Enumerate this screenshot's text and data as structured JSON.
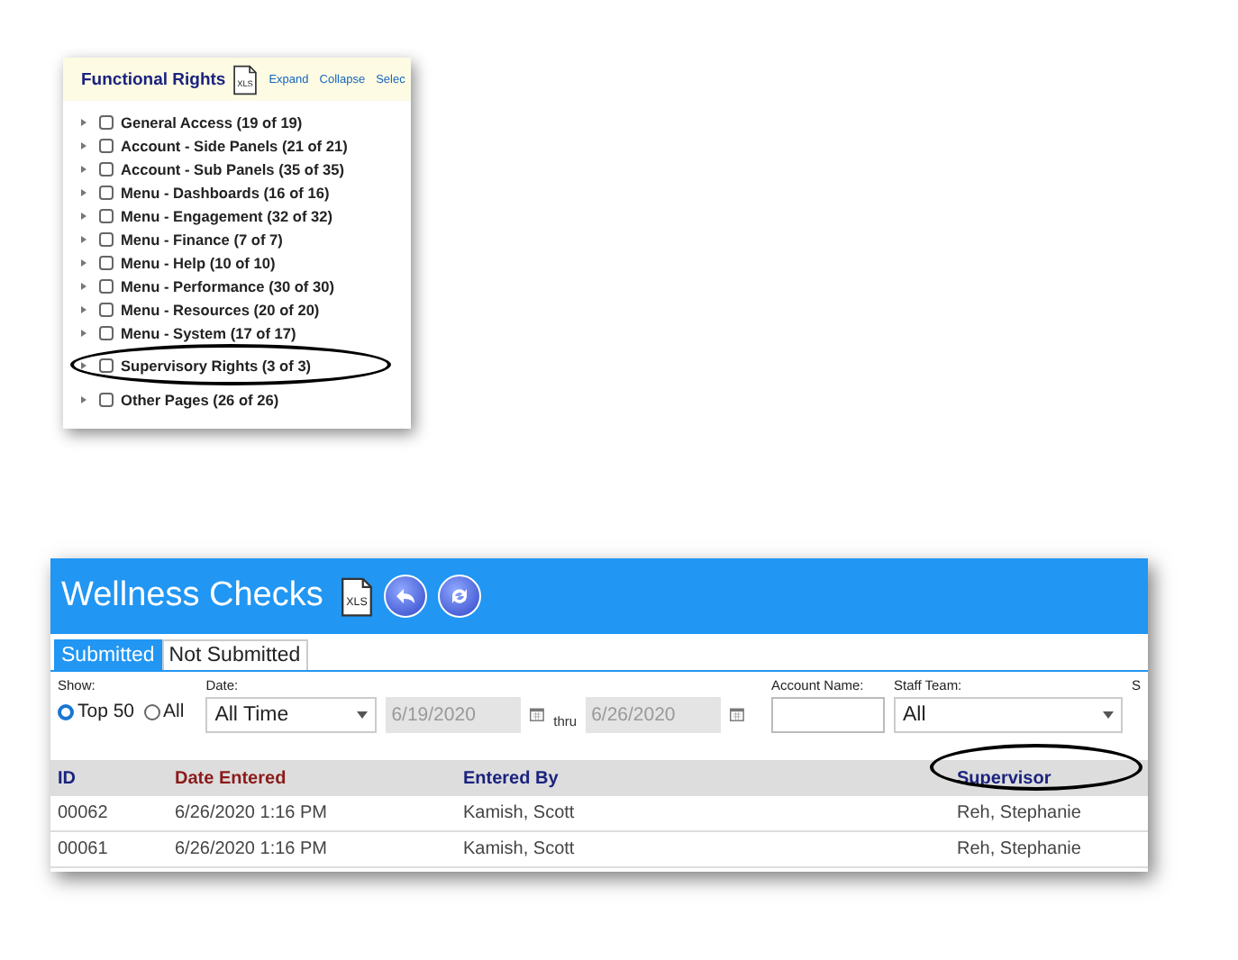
{
  "functional_rights": {
    "title": "Functional Rights",
    "xls_icon_label": "XLS",
    "header_links": [
      "Expand",
      "Collapse",
      "Selec"
    ],
    "items": [
      {
        "label": "General Access (19 of 19)",
        "checked": false,
        "circled": false
      },
      {
        "label": "Account - Side Panels (21 of 21)",
        "checked": false,
        "circled": false
      },
      {
        "label": "Account - Sub Panels (35 of 35)",
        "checked": false,
        "circled": false
      },
      {
        "label": "Menu - Dashboards (16 of 16)",
        "checked": false,
        "circled": false
      },
      {
        "label": "Menu - Engagement (32 of 32)",
        "checked": false,
        "circled": false
      },
      {
        "label": "Menu - Finance (7 of 7)",
        "checked": false,
        "circled": false
      },
      {
        "label": "Menu - Help (10 of 10)",
        "checked": false,
        "circled": false
      },
      {
        "label": "Menu - Performance (30 of 30)",
        "checked": false,
        "circled": false
      },
      {
        "label": "Menu - Resources (20 of 20)",
        "checked": false,
        "circled": false
      },
      {
        "label": "Menu - System (17 of 17)",
        "checked": false,
        "circled": false
      },
      {
        "label": "Supervisory Rights (3 of 3)",
        "checked": false,
        "circled": true
      },
      {
        "label": "Other Pages (26 of 26)",
        "checked": false,
        "circled": false
      }
    ]
  },
  "wellness_checks": {
    "title": "Wellness Checks",
    "xls_icon_label": "XLS",
    "tabs": [
      {
        "label": "Submitted",
        "selected": true
      },
      {
        "label": "Not Submitted",
        "selected": false
      }
    ],
    "filters": {
      "show_label": "Show:",
      "show_options": [
        {
          "label": "Top 50",
          "selected": true
        },
        {
          "label": "All",
          "selected": false
        }
      ],
      "date_label": "Date:",
      "date_value": "All Time",
      "from_date": "6/19/2020",
      "thru_label": "thru",
      "to_date": "6/26/2020",
      "account_label": "Account Name:",
      "staff_team_label": "Staff Team:",
      "staff_team_value": "All",
      "column_5_label": "S"
    },
    "table": {
      "columns": [
        {
          "label": "ID",
          "sorted": false,
          "circled": false
        },
        {
          "label": "Date Entered",
          "sorted": true,
          "circled": false
        },
        {
          "label": "Entered By",
          "sorted": false,
          "circled": false
        },
        {
          "label": "Supervisor",
          "sorted": false,
          "circled": true
        }
      ],
      "rows": [
        [
          "00062",
          "6/26/2020 1:16 PM",
          "Kamish, Scott",
          "Reh, Stephanie"
        ],
        [
          "00061",
          "6/26/2020 1:16 PM",
          "Kamish, Scott",
          "Reh, Stephanie"
        ]
      ]
    }
  }
}
